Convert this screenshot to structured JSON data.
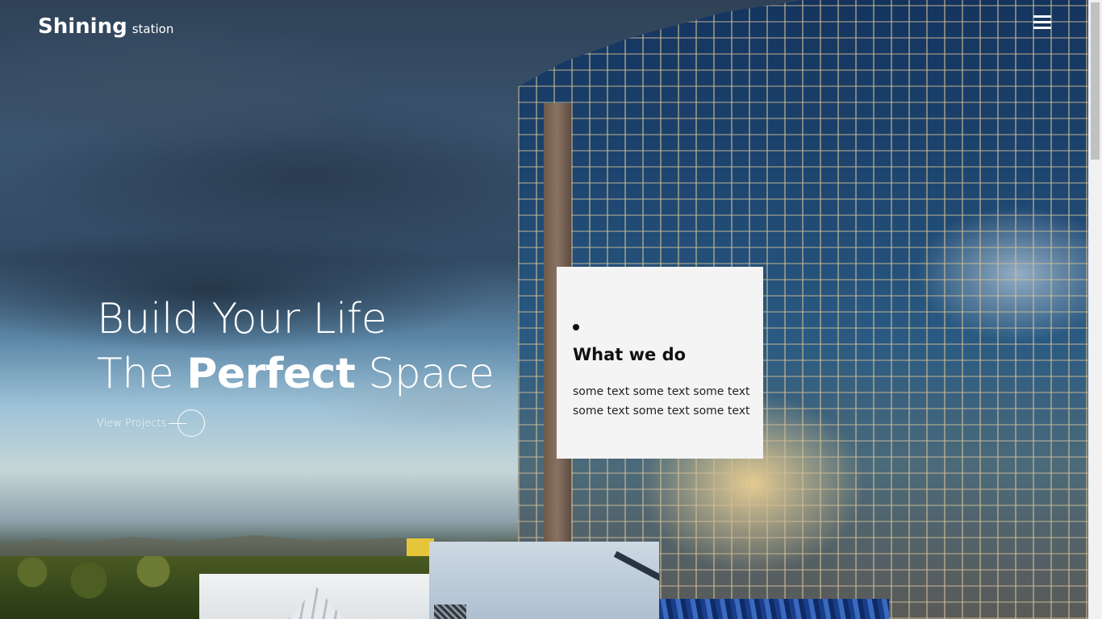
{
  "header": {
    "brand_name": "Shining",
    "brand_sub": "station",
    "menu_icon": "hamburger-menu-icon"
  },
  "hero": {
    "line1": "Build Your Life",
    "line2_prefix": "The",
    "line2_bold": "Perfect",
    "line2_suffix": "Space",
    "cta_label": "View Projects",
    "cta_icon": "arrow-circle-icon"
  },
  "card": {
    "title": "What we do",
    "text": "some text some text some text some text some text some text"
  },
  "colors": {
    "text_light": "#ffffff",
    "card_bg": "#f4f4f4",
    "card_text": "#111111"
  }
}
